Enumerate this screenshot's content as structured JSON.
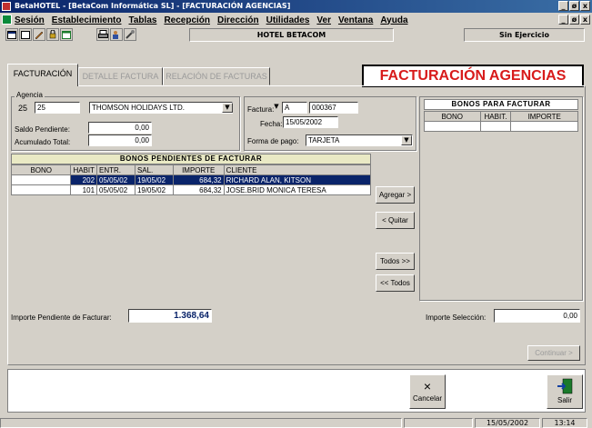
{
  "window": {
    "title": "BetaHOTEL - [BetaCom Informática SL] - [FACTURACIÓN AGENCIAS]",
    "controls": [
      "_",
      "ø",
      "x"
    ]
  },
  "menu": [
    "Sesión",
    "Establecimiento",
    "Tablas",
    "Recepción",
    "Dirección",
    "Utilidades",
    "Ver",
    "Ventana",
    "Ayuda"
  ],
  "toolbar": {
    "hotel": "HOTEL BETACOM",
    "ejercicio": "Sin Ejercicio"
  },
  "tabs": {
    "facturacion": "FACTURACIÓN",
    "detalle": "DETALLE FACTURA",
    "relacion": "RELACIÓN DE FACTURAS"
  },
  "page_title": "FACTURACIÓN AGENCIAS",
  "agencia": {
    "legend": "Agencia",
    "code1": "25",
    "code2": "25",
    "name": "THOMSON HOLIDAYS LTD.",
    "saldo_label": "Saldo Pendiente:",
    "saldo_value": "0,00",
    "acumulado_label": "Acumulado Total:",
    "acumulado_value": "0,00"
  },
  "factura": {
    "label": "Factura:",
    "serie": "A",
    "numero": "000367",
    "fecha_label": "Fecha:",
    "fecha": "15/05/2002",
    "forma_label": "Forma de pago:",
    "forma": "TARJETA"
  },
  "pendientes": {
    "title": "BONOS PENDIENTES DE FACTURAR",
    "headers": [
      "BONO",
      "HABIT",
      "ENTR.",
      "SAL.",
      "IMPORTE",
      "CLIENTE"
    ],
    "rows": [
      {
        "bono": "",
        "habit": "202",
        "entr": "05/05/02",
        "sal": "19/05/02",
        "importe": "684,32",
        "cliente": "RICHARD ALAN, KITSON"
      },
      {
        "bono": "",
        "habit": "101",
        "entr": "05/05/02",
        "sal": "19/05/02",
        "importe": "684,32",
        "cliente": "JOSE.BRID MONICA TERESA"
      }
    ]
  },
  "facturar": {
    "title": "BONOS PARA FACTURAR",
    "headers": [
      "BONO",
      "HABIT.",
      "IMPORTE"
    ]
  },
  "buttons": {
    "agregar": "Agregar >",
    "quitar": "< Quitar",
    "todos": "Todos >>",
    "todos_back": "<< Todos",
    "continuar": "Continuar >"
  },
  "importe_pendiente": {
    "label": "Importe Pendiente de Facturar:",
    "value": "1.368,64"
  },
  "importe_seleccion": {
    "label": "Importe Selección:",
    "value": "0,00"
  },
  "actions": {
    "cancelar": "Cancelar",
    "salir": "Salir"
  },
  "status": {
    "date": "15/05/2002",
    "time": "13:14"
  }
}
